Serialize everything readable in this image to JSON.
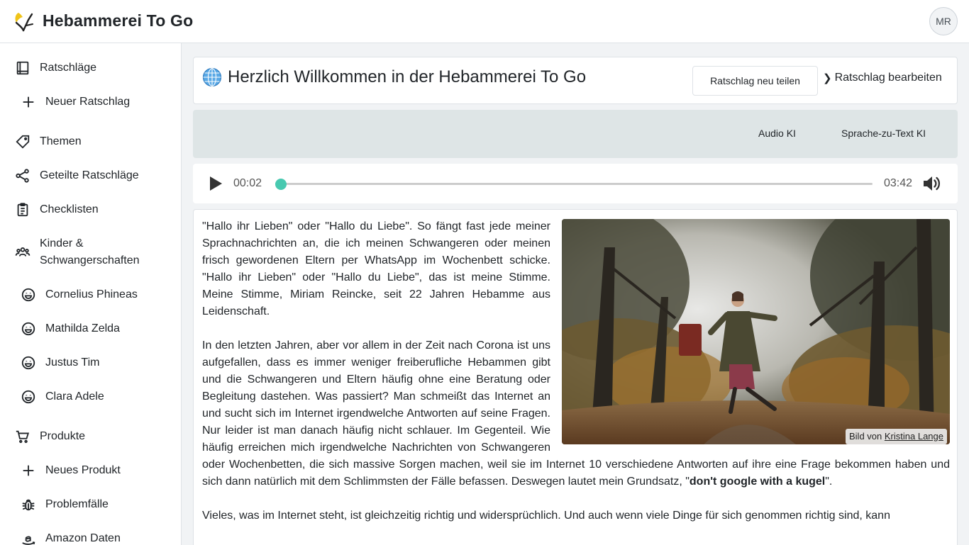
{
  "app": {
    "title": "Hebammerei To Go",
    "user_initials": "MR",
    "accent": "#48c9b0"
  },
  "sidebar": {
    "items": [
      {
        "label": "Ratschläge",
        "icon": "book-icon"
      },
      {
        "label": "Neuer Ratschlag",
        "icon": "plus-icon"
      },
      {
        "label": "Themen",
        "icon": "tag-icon"
      },
      {
        "label": "Geteilte Ratschläge",
        "icon": "share-icon"
      },
      {
        "label": "Checklisten",
        "icon": "clipboard-icon"
      },
      {
        "label": "Kinder & Schwangerschaften",
        "icon": "users-icon"
      },
      {
        "label": "Cornelius Phineas",
        "icon": "smiley-icon"
      },
      {
        "label": "Mathilda Zelda",
        "icon": "smiley-icon"
      },
      {
        "label": "Justus Tim",
        "icon": "smiley-icon"
      },
      {
        "label": "Clara Adele",
        "icon": "smiley-icon"
      },
      {
        "label": "Produkte",
        "icon": "cart-icon"
      },
      {
        "label": "Neues Produkt",
        "icon": "plus-icon"
      },
      {
        "label": "Problemfälle",
        "icon": "bug-icon"
      },
      {
        "label": "Amazon Daten",
        "icon": "amazon-icon"
      }
    ]
  },
  "header": {
    "title": "Herzlich Willkommen in der Hebammerei To Go",
    "share_button": "Ratschlag neu teilen",
    "edit_button": "Ratschlag bearbeiten",
    "edit_chevron": "❯"
  },
  "tabs": {
    "audio": "Audio KI",
    "speech": "Sprache-zu-Text KI"
  },
  "player": {
    "current_time": "00:02",
    "total_time": "03:42",
    "progress": 0.01
  },
  "article": {
    "image_credit_prefix": "Bild von",
    "image_credit_author": "Kristina Lange",
    "p1": "\"Hallo ihr Lieben\" oder \"Hallo du Liebe\". So fängt fast jede meiner Sprachnachrichten an, die ich meinen Schwangeren oder meinen frisch gewordenen Eltern per WhatsApp im Wochenbett schicke. \"Hallo ihr Lieben\" oder \"Hallo du Liebe\", das ist meine Stimme. Meine Stimme, Miriam Reincke, seit 22 Jahren Hebamme aus Leidenschaft.",
    "p2_start": "In den letzten Jahren, aber vor allem in der Zeit nach Corona ist uns aufgefallen, dass es immer weniger freiberufliche Hebammen gibt und die Schwangeren und Eltern häufig ohne eine Beratung oder Begleitung dastehen. Was passiert? Man schmeißt das Internet an und sucht sich im Internet irgendwelche Antworten auf seine Fragen. Nur leider ist man danach häufig nicht schlauer. Im Gegenteil. Wie häufig erreichen mich irgendwelche Nachrichten von Schwangeren oder Wochenbetten, die sich massive Sorgen machen, weil sie im Internet 10 verschiedene Antworten auf ihre eine Frage bekommen haben und sich dann natürlich mit dem Schlimmsten der Fälle befassen. Deswegen lautet mein Grundsatz, \"",
    "p2_bold": "don't google with a kugel",
    "p2_end": "\".",
    "p3": "Vieles, was im Internet steht, ist gleichzeitig richtig und widersprüchlich. Und auch wenn viele Dinge für sich genommen richtig sind, kann"
  }
}
